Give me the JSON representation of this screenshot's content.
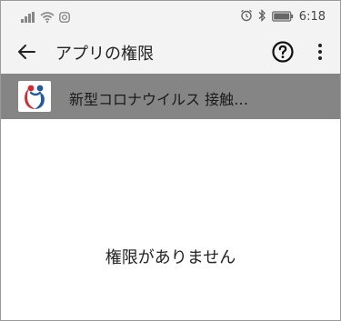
{
  "status_bar": {
    "time": "6:18",
    "signal_icon": "signal-bars-icon",
    "wifi_icon": "wifi-icon",
    "instagram_icon": "instagram-icon",
    "alarm_icon": "alarm-clock-icon",
    "bluetooth_icon": "bluetooth-icon",
    "battery_icon": "battery-icon"
  },
  "app_bar": {
    "title": "アプリの権限",
    "back_icon": "arrow-back-icon",
    "help_icon": "help-circle-icon",
    "more_icon": "more-vert-icon"
  },
  "app_row": {
    "name": "新型コロナウイルス 接触…",
    "icon": "app-logo-icon"
  },
  "content": {
    "empty_message": "権限がありません"
  },
  "colors": {
    "bar_background": "#f3f3f3",
    "selected_row": "#858585",
    "logo_red": "#d7262c",
    "logo_blue": "#1e5aa8"
  }
}
